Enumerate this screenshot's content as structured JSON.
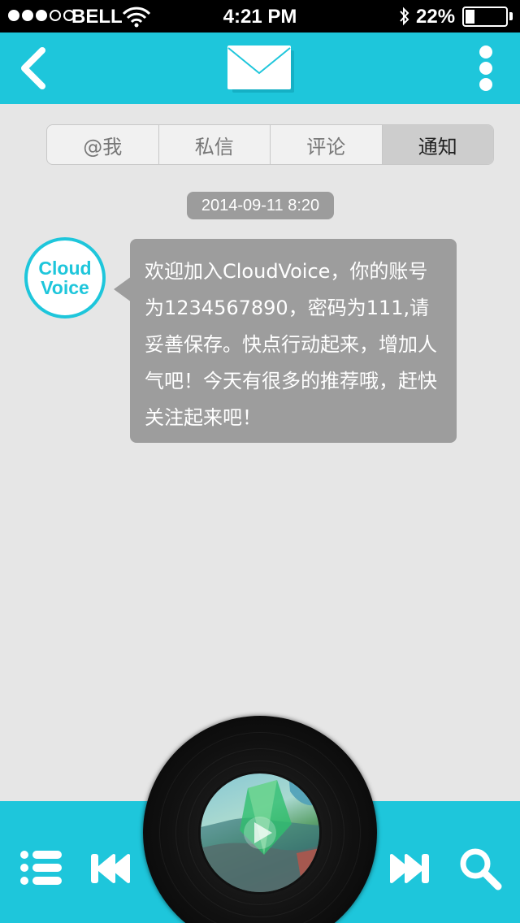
{
  "status_bar": {
    "carrier": "BELL",
    "time": "4:21 PM",
    "battery_percent": "22%",
    "battery_level": 0.22,
    "signal_bars_filled": 3,
    "signal_bars_total": 5
  },
  "header": {
    "back_icon": "chevron-left-icon",
    "center_icon": "envelope-icon",
    "menu_icon": "vertical-dots-icon"
  },
  "tabs": [
    {
      "label": "@我",
      "active": false
    },
    {
      "label": "私信",
      "active": false
    },
    {
      "label": "评论",
      "active": false
    },
    {
      "label": "通知",
      "active": true
    }
  ],
  "message": {
    "timestamp": "2014-09-11 8:20",
    "avatar_line1": "Cloud",
    "avatar_line2": "Voice",
    "text": "欢迎加入CloudVoice，你的账号为1234567890，密码为111,请妥善保存。快点行动起来，增加人气吧！今天有很多的推荐哦，赶快关注起来吧！"
  },
  "player": {
    "controls": [
      "playlist-icon",
      "previous-icon",
      "next-icon",
      "search-icon"
    ]
  },
  "colors": {
    "accent": "#1ec6db",
    "bubble": "#9d9d9d",
    "background": "#e6e6e6"
  }
}
